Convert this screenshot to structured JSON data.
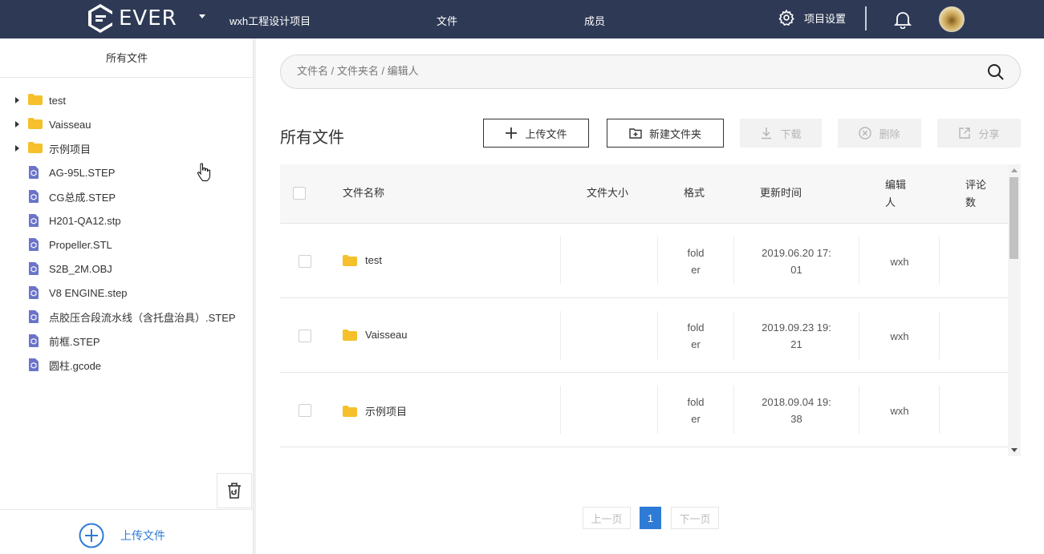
{
  "header": {
    "logo_text": "EVER",
    "project_name": "wxh工程设计项目",
    "nav": {
      "files": "文件",
      "members": "成员"
    },
    "settings_label": "项目设置"
  },
  "sidebar": {
    "title": "所有文件",
    "items": [
      {
        "label": "test",
        "type": "folder"
      },
      {
        "label": "Vaisseau",
        "type": "folder"
      },
      {
        "label": "示例项目",
        "type": "folder"
      },
      {
        "label": "AG-95L.STEP",
        "type": "model"
      },
      {
        "label": "CG总成.STEP",
        "type": "model"
      },
      {
        "label": "H201-QA12.stp",
        "type": "model"
      },
      {
        "label": "Propeller.STL",
        "type": "model"
      },
      {
        "label": "S2B_2M.OBJ",
        "type": "model"
      },
      {
        "label": "V8 ENGINE.step",
        "type": "model"
      },
      {
        "label": "点胶压合段流水线（含托盘治具）.STEP",
        "type": "model"
      },
      {
        "label": "前框.STEP",
        "type": "model"
      },
      {
        "label": "圆柱.gcode",
        "type": "model"
      }
    ],
    "upload_label": "上传文件"
  },
  "search": {
    "placeholder": "文件名 / 文件夹名 / 编辑人",
    "value": ""
  },
  "main": {
    "title": "所有文件",
    "buttons": {
      "upload": "上传文件",
      "new_folder": "新建文件夹",
      "download": "下载",
      "delete": "删除",
      "share": "分享"
    }
  },
  "table": {
    "headers": {
      "name": "文件名称",
      "size": "文件大小",
      "format": "格式",
      "updated": "更新时间",
      "editor_1": "编辑",
      "editor_2": "人",
      "comments_1": "评论",
      "comments_2": "数"
    },
    "rows": [
      {
        "name": "test",
        "size": "",
        "format_1": "fold",
        "format_2": "er",
        "updated_1": "2019.06.20 17:",
        "updated_2": "01",
        "editor": "wxh"
      },
      {
        "name": "Vaisseau",
        "size": "",
        "format_1": "fold",
        "format_2": "er",
        "updated_1": "2019.09.23 19:",
        "updated_2": "21",
        "editor": "wxh"
      },
      {
        "name": "示例项目",
        "size": "",
        "format_1": "fold",
        "format_2": "er",
        "updated_1": "2018.09.04 19:",
        "updated_2": "38",
        "editor": "wxh"
      }
    ]
  },
  "pagination": {
    "prev": "上一页",
    "current": "1",
    "next": "下一页"
  },
  "colors": {
    "header_bg": "#2e3a55",
    "accent": "#2e7bd6",
    "folder": "#f5c02b",
    "model_icon": "#6b73c9"
  }
}
